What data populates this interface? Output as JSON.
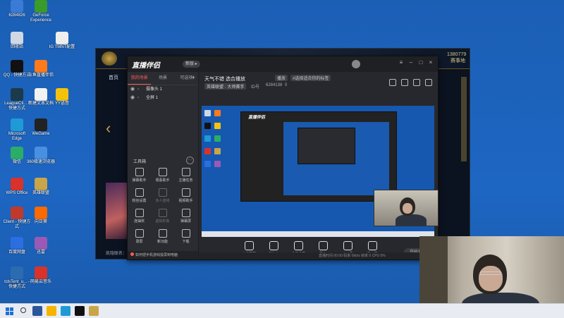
{
  "desktop": {
    "icons": [
      {
        "label": "6284826",
        "color": "#3a7bd5"
      },
      {
        "label": "GeForce Experience",
        "color": "#3a9a2a"
      },
      {
        "label": "回收站",
        "color": "#d0d8e4"
      },
      {
        "label": "IG TMNT配置",
        "color": "#eeeeee"
      },
      {
        "label": "QQ - 快捷方式",
        "color": "#111111"
      },
      {
        "label": "斗鱼直播伴侣",
        "color": "#ff7a1a"
      },
      {
        "label": "LeagueCli... - 快捷方式",
        "color": "#1b3a4a"
      },
      {
        "label": "新建文本文档",
        "color": "#f2f2f2"
      },
      {
        "label": "YY语音",
        "color": "#f4c20d"
      },
      {
        "label": "Microsoft Edge",
        "color": "#1f9ad6"
      },
      {
        "label": "WeGame",
        "color": "#222222"
      },
      {
        "label": "微信",
        "color": "#2aae67"
      },
      {
        "label": "360极速浏览器",
        "color": "#4a90e2"
      },
      {
        "label": "WPS Office",
        "color": "#d9322b"
      },
      {
        "label": "英雄联盟",
        "color": "#c9a54a"
      },
      {
        "label": "Client - 快捷方式",
        "color": "#c0392b"
      },
      {
        "label": "向日葵",
        "color": "#ff6a00"
      },
      {
        "label": "百度网盘",
        "color": "#2a6ee0"
      },
      {
        "label": "迅雷",
        "color": "#9b59b6"
      },
      {
        "label": "tclsTent_u... - 快捷方式",
        "color": "#2b6cb0"
      },
      {
        "label": "网易云音乐",
        "color": "#d9322b"
      }
    ]
  },
  "game": {
    "points": "1380779",
    "right_label": "赛事地",
    "nav_first": "首页",
    "bottom_text": "凯隐联名：1.1"
  },
  "app": {
    "logo": "直播伴侣",
    "badge": "新版 ▸",
    "tabs": [
      "我的场景",
      "场景",
      "可选项"
    ],
    "scenes": [
      "摄像头 1",
      "全屏 1"
    ],
    "toolbox_title": "工具箱",
    "tools": [
      {
        "label": "弹幕助手",
        "dim": false
      },
      {
        "label": "观看助手",
        "dim": false
      },
      {
        "label": "主播任务",
        "dim": false
      },
      {
        "label": "粉丝设置",
        "dim": false
      },
      {
        "label": "多人连线",
        "dim": true
      },
      {
        "label": "视频助手",
        "dim": false
      },
      {
        "label": "连抽奖",
        "dim": false
      },
      {
        "label": "虚拟形象",
        "dim": true
      },
      {
        "label": "弹幕屏",
        "dim": false
      },
      {
        "label": "录屏",
        "dim": false
      },
      {
        "label": "新功能",
        "dim": false
      },
      {
        "label": "下载",
        "dim": false
      }
    ],
    "notice": "如何把手机游戏投屏到电脑",
    "room": {
      "title": "天气不错 选合播放",
      "category": "播放",
      "tag": "#选择适合你的标签",
      "sub1": "英雄联盟 · 大师赛手",
      "id_label": "ID号",
      "id_value": "6284138",
      "fans": "0"
    },
    "preview_logo": "直播伴侣",
    "controls": [
      "直播屏幕",
      "摄像头",
      "手机投屏",
      "录像",
      "麦克风",
      "扬声器"
    ],
    "go_live": "开始直播",
    "status": "直播时间 00:00   码率 0kb/s   帧率 0   CPU 0%"
  }
}
